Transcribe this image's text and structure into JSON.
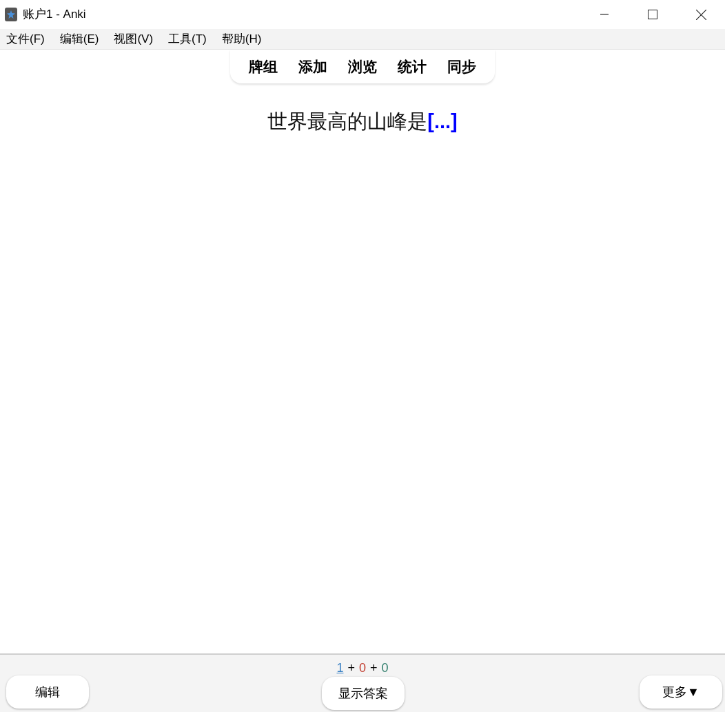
{
  "window": {
    "title": "账户1 - Anki"
  },
  "menu": [
    "文件(F)",
    "编辑(E)",
    "视图(V)",
    "工具(T)",
    "帮助(H)"
  ],
  "toolbar": [
    "牌组",
    "添加",
    "浏览",
    "统计",
    "同步"
  ],
  "card": {
    "question": "世界最高的山峰是",
    "cloze": "[...]"
  },
  "counts": [
    {
      "kind": "count",
      "text": "1",
      "color": "#3b82c4",
      "selected": true
    },
    {
      "kind": "separator",
      "text": "+"
    },
    {
      "kind": "count",
      "text": "0",
      "color": "#c0392b",
      "selected": false
    },
    {
      "kind": "separator",
      "text": "+"
    },
    {
      "kind": "count",
      "text": "0",
      "color": "#2e7d6a",
      "selected": false
    }
  ],
  "bottom_buttons": {
    "left": "编辑",
    "center": "显示答案",
    "right": "更多▼"
  }
}
